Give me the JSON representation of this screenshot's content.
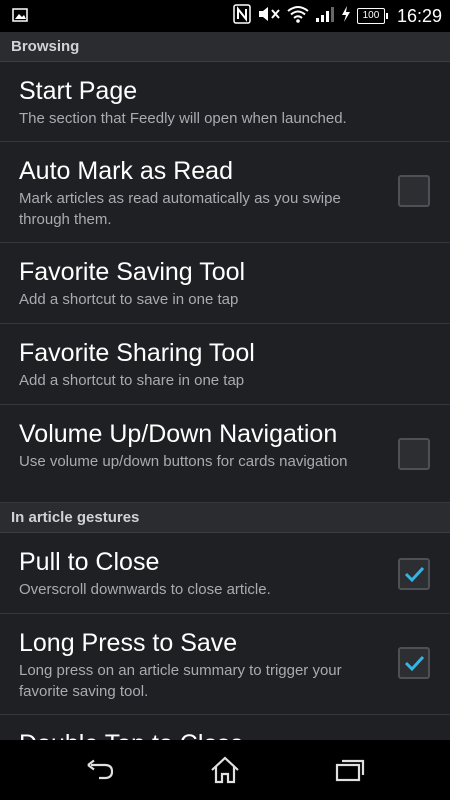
{
  "status_bar": {
    "time": "16:29",
    "battery": "100",
    "icons": [
      "image-notification-icon",
      "nfc-icon",
      "mute-icon",
      "wifi-icon",
      "signal-icon",
      "charging-icon",
      "battery-icon"
    ]
  },
  "sections": [
    {
      "header": "Browsing",
      "items": [
        {
          "title": "Start Page",
          "summary": "The section that Feedly will open when launched.",
          "checkbox": null
        },
        {
          "title": "Auto Mark as Read",
          "summary": "Mark articles as read automatically as you swipe through them.",
          "checkbox": false
        },
        {
          "title": "Favorite Saving Tool",
          "summary": "Add a shortcut to save in one tap",
          "checkbox": null
        },
        {
          "title": "Favorite Sharing Tool",
          "summary": "Add a shortcut to share in one tap",
          "checkbox": null
        },
        {
          "title": "Volume Up/Down Navigation",
          "summary": "Use volume up/down buttons for cards navigation",
          "checkbox": false
        }
      ]
    },
    {
      "header": "In article gestures",
      "items": [
        {
          "title": "Pull to Close",
          "summary": "Overscroll downwards to close article.",
          "checkbox": true
        },
        {
          "title": "Long Press to Save",
          "summary": "Long press on an article summary to trigger your favorite saving tool.",
          "checkbox": true
        },
        {
          "title": "Double Tap to Close",
          "summary": "",
          "checkbox": false
        }
      ]
    }
  ],
  "nav_bar": {
    "buttons": [
      "back-icon",
      "home-icon",
      "recent-apps-icon"
    ]
  },
  "colors": {
    "check_accent": "#33b5e5",
    "background": "#1e2023",
    "section_header_bg": "#2a2c30"
  }
}
